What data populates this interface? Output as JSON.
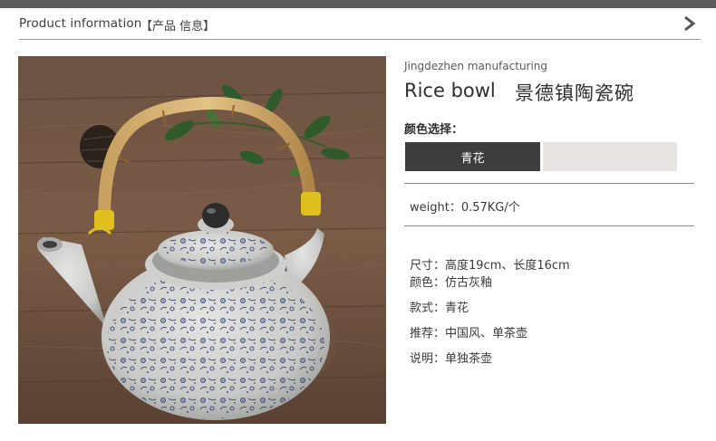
{
  "header": {
    "title": "Product information",
    "title_cn": "【产品 信息】",
    "next_icon": "chevron-right-icon"
  },
  "photo": {
    "subject": "teapot-image"
  },
  "product": {
    "maker": "Jingdezhen manufacturing",
    "name_en": "Rice bowl",
    "name_cn": "景德镇陶瓷碗"
  },
  "color_select": {
    "label": "颜色选择：",
    "options": [
      {
        "label": "青花",
        "selected": true,
        "color": "#3f3c3c"
      },
      {
        "label": "",
        "selected": false,
        "color": "#e8e5e3"
      }
    ]
  },
  "weight": "weight：0.57KG/个",
  "specs": [
    "尺寸：高度19cm、长度16cm",
    "颜色：仿古灰釉",
    "款式：青花",
    "推荐：中国风、单茶壶",
    "说明：单独茶壶"
  ],
  "colors": {
    "top_bar": "#5d5d5d",
    "rule": "#8a8a8a",
    "swatch_dark": "#3f3c3c",
    "swatch_light": "#e8e5e3"
  }
}
